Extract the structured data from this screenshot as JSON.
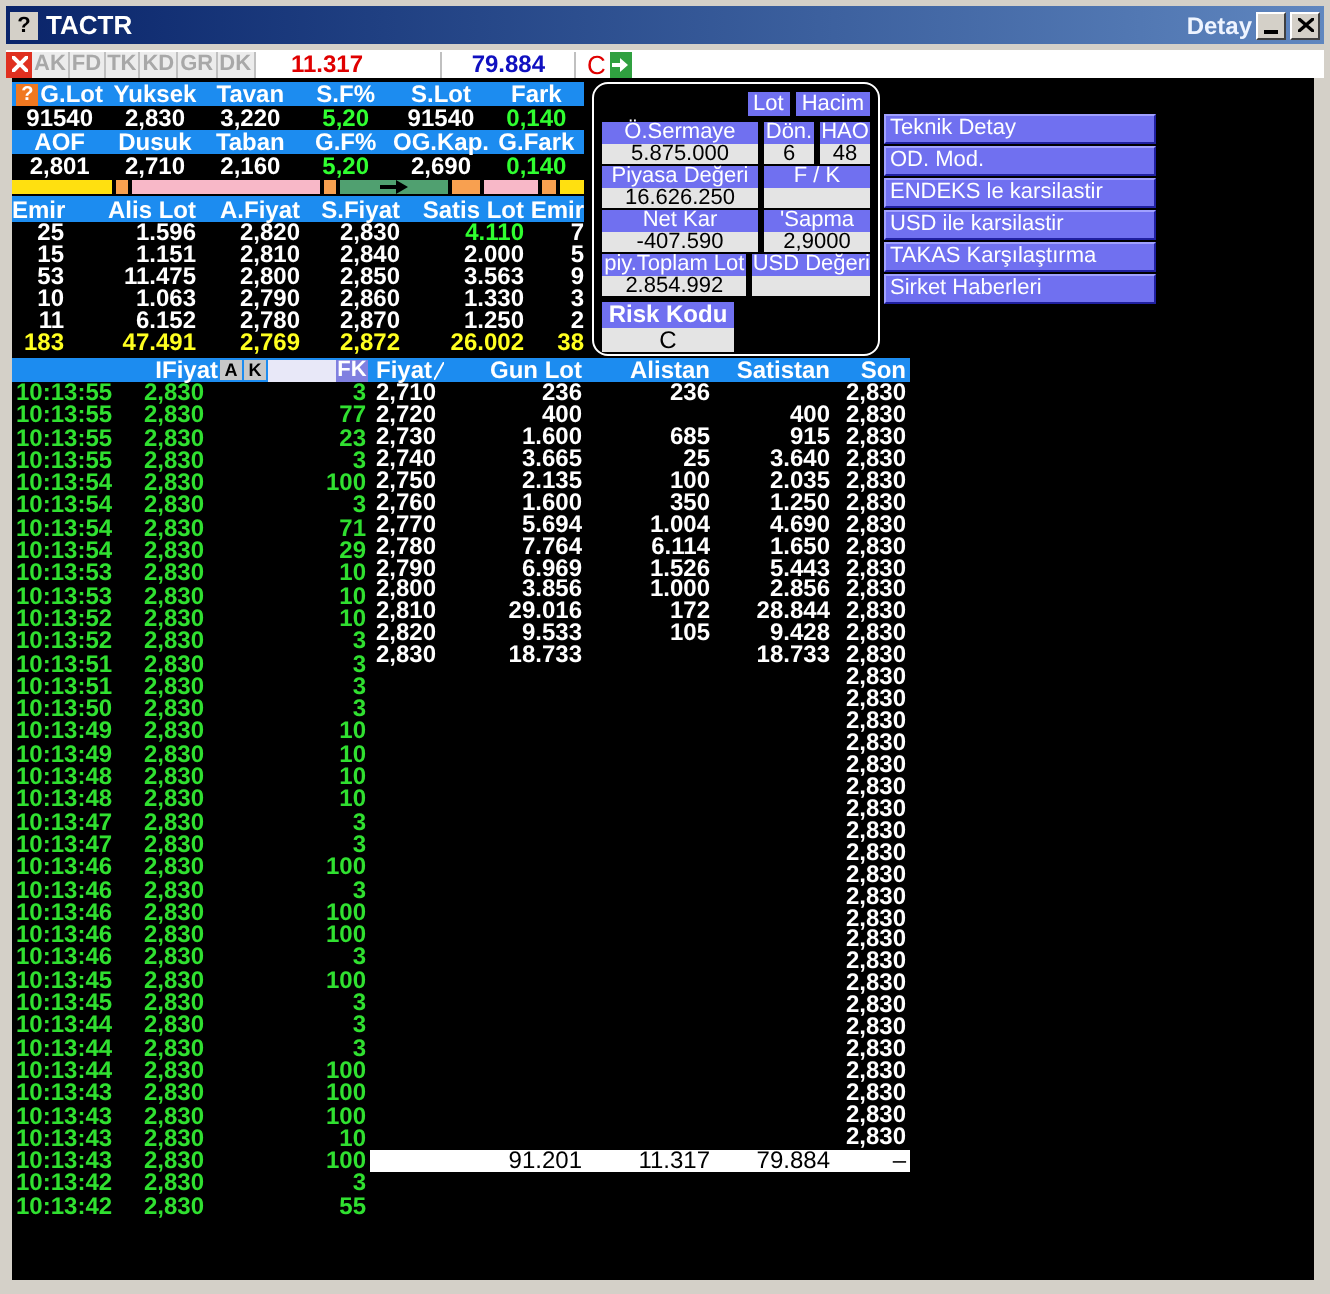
{
  "window": {
    "help_mark": "?",
    "title": "TACTR",
    "detail_label": "Detay"
  },
  "toolbar": {
    "buttons": [
      "AK",
      "FD",
      "TK",
      "KD",
      "GR",
      "DK"
    ],
    "value_1": "11.317",
    "value_2": "79.884",
    "flag": "C"
  },
  "summary": {
    "help_mark": "?",
    "rows": [
      {
        "headers": [
          "G.Lot",
          "Yuksek",
          "Tavan",
          "S.F%",
          "S.Lot",
          "Fark"
        ],
        "values": [
          {
            "text": "91540",
            "up": false
          },
          {
            "text": "2,830",
            "up": false
          },
          {
            "text": "3,220",
            "up": false
          },
          {
            "text": "5,20",
            "up": true
          },
          {
            "text": "91540",
            "up": false
          },
          {
            "text": "0,140",
            "up": true
          }
        ]
      },
      {
        "headers": [
          "AOF",
          "Dusuk",
          "Taban",
          "G.F%",
          "OG.Kap.",
          "G.Fark"
        ],
        "values": [
          {
            "text": "2,801",
            "up": false
          },
          {
            "text": "2,710",
            "up": false
          },
          {
            "text": "2,160",
            "up": false
          },
          {
            "text": "5,20",
            "up": true
          },
          {
            "text": "2,690",
            "up": false
          },
          {
            "text": "0,140",
            "up": true
          }
        ]
      }
    ]
  },
  "depth": {
    "columns": [
      "Emir",
      "Alis Lot",
      "A.Fiyat",
      "S.Fiyat",
      "Satis Lot",
      "Emir"
    ],
    "rows": [
      {
        "cells": [
          "25",
          "1.596",
          "2,820",
          "2,830",
          "4.110",
          "7"
        ],
        "best_ask": true
      },
      {
        "cells": [
          "15",
          "1.151",
          "2,810",
          "2,840",
          "2.000",
          "5"
        ],
        "best_ask": false
      },
      {
        "cells": [
          "53",
          "11.475",
          "2,800",
          "2,850",
          "3.563",
          "9"
        ],
        "best_ask": false
      },
      {
        "cells": [
          "10",
          "1.063",
          "2,790",
          "2,860",
          "1.330",
          "3"
        ],
        "best_ask": false
      },
      {
        "cells": [
          "11",
          "6.152",
          "2,780",
          "2,870",
          "1.250",
          "2"
        ],
        "best_ask": false
      }
    ],
    "totals": [
      "183",
      "47.491",
      "2,769",
      "2,872",
      "26.002",
      "38"
    ]
  },
  "details": {
    "toggles": [
      "Lot",
      "Hacim"
    ],
    "rows": [
      [
        {
          "label": "Ö.Sermaye",
          "value": "5.875.000"
        },
        {
          "label": "Dön.",
          "value": "6"
        },
        {
          "label": "HAO",
          "value": "48"
        }
      ],
      [
        {
          "label": "Piyasa Değeri",
          "value": "16.626.250"
        },
        {
          "label": "F / K"
        }
      ],
      [
        {
          "label": "Net Kar",
          "value": "-407.590"
        },
        {
          "label": "'Sapma",
          "value": "2,9000"
        }
      ],
      [
        {
          "label": "piy.Toplam Lot",
          "value": "2.854.992"
        },
        {
          "label": "USD Değeri"
        }
      ]
    ],
    "risk": {
      "label": "Risk Kodu",
      "value": "C"
    }
  },
  "menu": [
    "Teknik Detay",
    "OD. Mod.",
    "ENDEKS le karsilastir",
    "USD ile karsilastir",
    "TAKAS Karşılaştırma",
    "Sirket Haberleri"
  ],
  "trades_header": {
    "label": "IFiyat",
    "buttons": [
      "A",
      "K"
    ],
    "fk": "FK"
  },
  "trades": [
    [
      "10:13:55",
      "2,830",
      "3"
    ],
    [
      "10:13:55",
      "2,830",
      "77"
    ],
    [
      "10:13:55",
      "2,830",
      "23"
    ],
    [
      "10:13:55",
      "2,830",
      "3"
    ],
    [
      "10:13:54",
      "2,830",
      "100"
    ],
    [
      "10:13:54",
      "2,830",
      "3"
    ],
    [
      "10:13:54",
      "2,830",
      "71"
    ],
    [
      "10:13:54",
      "2,830",
      "29"
    ],
    [
      "10:13:53",
      "2,830",
      "10"
    ],
    [
      "10:13:53",
      "2,830",
      "10"
    ],
    [
      "10:13:52",
      "2,830",
      "10"
    ],
    [
      "10:13:52",
      "2,830",
      "3"
    ],
    [
      "10:13:51",
      "2,830",
      "3"
    ],
    [
      "10:13:51",
      "2,830",
      "3"
    ],
    [
      "10:13:50",
      "2,830",
      "3"
    ],
    [
      "10:13:49",
      "2,830",
      "10"
    ],
    [
      "10:13:49",
      "2,830",
      "10"
    ],
    [
      "10:13:48",
      "2,830",
      "10"
    ],
    [
      "10:13:48",
      "2,830",
      "10"
    ],
    [
      "10:13:47",
      "2,830",
      "3"
    ],
    [
      "10:13:47",
      "2,830",
      "3"
    ],
    [
      "10:13:46",
      "2,830",
      "100"
    ],
    [
      "10:13:46",
      "2,830",
      "3"
    ],
    [
      "10:13:46",
      "2,830",
      "100"
    ],
    [
      "10:13:46",
      "2,830",
      "100"
    ],
    [
      "10:13:46",
      "2,830",
      "3"
    ],
    [
      "10:13:45",
      "2,830",
      "100"
    ],
    [
      "10:13:45",
      "2,830",
      "3"
    ],
    [
      "10:13:44",
      "2,830",
      "3"
    ],
    [
      "10:13:44",
      "2,830",
      "3"
    ],
    [
      "10:13:44",
      "2,830",
      "100"
    ],
    [
      "10:13:43",
      "2,830",
      "100"
    ],
    [
      "10:13:43",
      "2,830",
      "100"
    ],
    [
      "10:13:43",
      "2,830",
      "10"
    ],
    [
      "10:13:43",
      "2,830",
      "100"
    ],
    [
      "10:13:42",
      "2,830",
      "3"
    ],
    [
      "10:13:42",
      "2,830",
      "55"
    ]
  ],
  "price_table": {
    "columns": [
      "Fiyat",
      "Gun Lot",
      "Alistan",
      "Satistan",
      "Son"
    ],
    "rows": [
      {
        "fiyat": "2,710",
        "gun_lot": "236",
        "alistan": "236",
        "son": "2,830"
      },
      {
        "fiyat": "2,720",
        "gun_lot": "400",
        "satistan": "400",
        "son": "2,830"
      },
      {
        "fiyat": "2,730",
        "gun_lot": "1.600",
        "alistan": "685",
        "satistan": "915",
        "son": "2,830"
      },
      {
        "fiyat": "2,740",
        "gun_lot": "3.665",
        "alistan": "25",
        "satistan": "3.640",
        "son": "2,830"
      },
      {
        "fiyat": "2,750",
        "gun_lot": "2.135",
        "alistan": "100",
        "satistan": "2.035",
        "son": "2,830"
      },
      {
        "fiyat": "2,760",
        "gun_lot": "1.600",
        "alistan": "350",
        "satistan": "1.250",
        "son": "2,830"
      },
      {
        "fiyat": "2,770",
        "gun_lot": "5.694",
        "alistan": "1.004",
        "satistan": "4.690",
        "son": "2,830"
      },
      {
        "fiyat": "2,780",
        "gun_lot": "7.764",
        "alistan": "6.114",
        "satistan": "1.650",
        "son": "2,830"
      },
      {
        "fiyat": "2,790",
        "gun_lot": "6.969",
        "alistan": "1.526",
        "satistan": "5.443",
        "son": "2,830"
      },
      {
        "fiyat": "2,800",
        "gun_lot": "3.856",
        "alistan": "1.000",
        "satistan": "2.856",
        "son": "2,830"
      },
      {
        "fiyat": "2,810",
        "gun_lot": "29.016",
        "alistan": "172",
        "satistan": "28.844",
        "son": "2,830"
      },
      {
        "fiyat": "2,820",
        "gun_lot": "9.533",
        "alistan": "105",
        "satistan": "9.428",
        "son": "2,830"
      },
      {
        "fiyat": "2,830",
        "gun_lot": "18.733",
        "satistan": "18.733",
        "son": "2,830"
      },
      {
        "son": "2,830"
      },
      {
        "son": "2,830"
      },
      {
        "son": "2,830"
      },
      {
        "son": "2,830"
      },
      {
        "son": "2,830"
      },
      {
        "son": "2,830"
      },
      {
        "son": "2,830"
      },
      {
        "son": "2,830"
      },
      {
        "son": "2,830"
      },
      {
        "son": "2,830"
      },
      {
        "son": "2,830"
      },
      {
        "son": "2,830"
      },
      {
        "son": "2,830"
      },
      {
        "son": "2,830"
      },
      {
        "son": "2,830"
      },
      {
        "son": "2,830"
      },
      {
        "son": "2,830"
      },
      {
        "son": "2,830"
      },
      {
        "son": "2,830"
      },
      {
        "son": "2,830"
      },
      {
        "son": "2,830"
      },
      {
        "son": "2,830"
      }
    ],
    "total": {
      "gun_lot": "91.201",
      "alistan": "11.317",
      "satistan": "79.884",
      "son": "–"
    }
  }
}
